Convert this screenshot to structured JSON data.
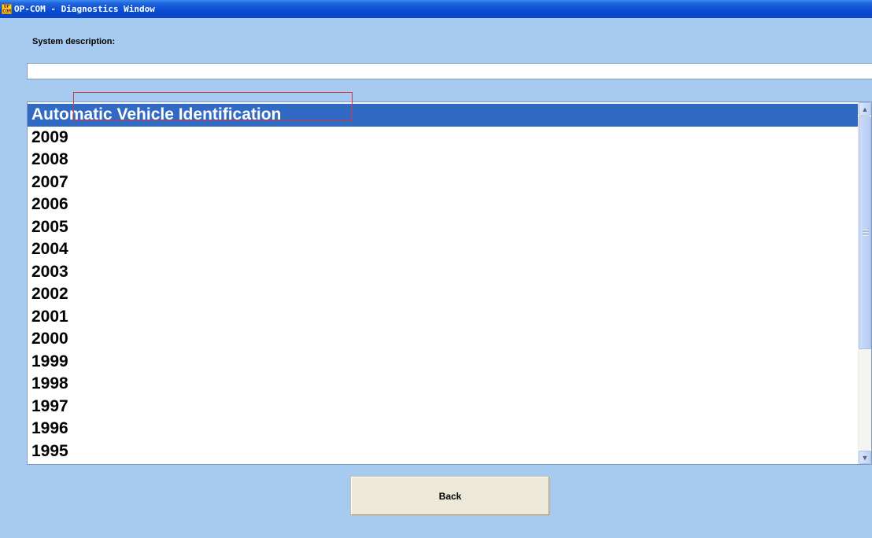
{
  "window": {
    "title": "OP-COM - Diagnostics Window",
    "icon": "op-com-app-icon",
    "icon_text": "OP\nCOM"
  },
  "system_description": {
    "label": "System description:",
    "value": ""
  },
  "list": {
    "selected_index": 0,
    "items": [
      "Automatic Vehicle Identification",
      "2009",
      "2008",
      "2007",
      "2006",
      "2005",
      "2004",
      "2003",
      "2002",
      "2001",
      "2000",
      "1999",
      "1998",
      "1997",
      "1996",
      "1995"
    ]
  },
  "scrollbar": {
    "up_icon": "chevron-up-icon",
    "down_icon": "chevron-down-icon"
  },
  "buttons": {
    "back_label": "Back"
  },
  "colors": {
    "background": "#a6caf0",
    "selection": "#316ac5",
    "highlight_box": "#d23a3a"
  }
}
